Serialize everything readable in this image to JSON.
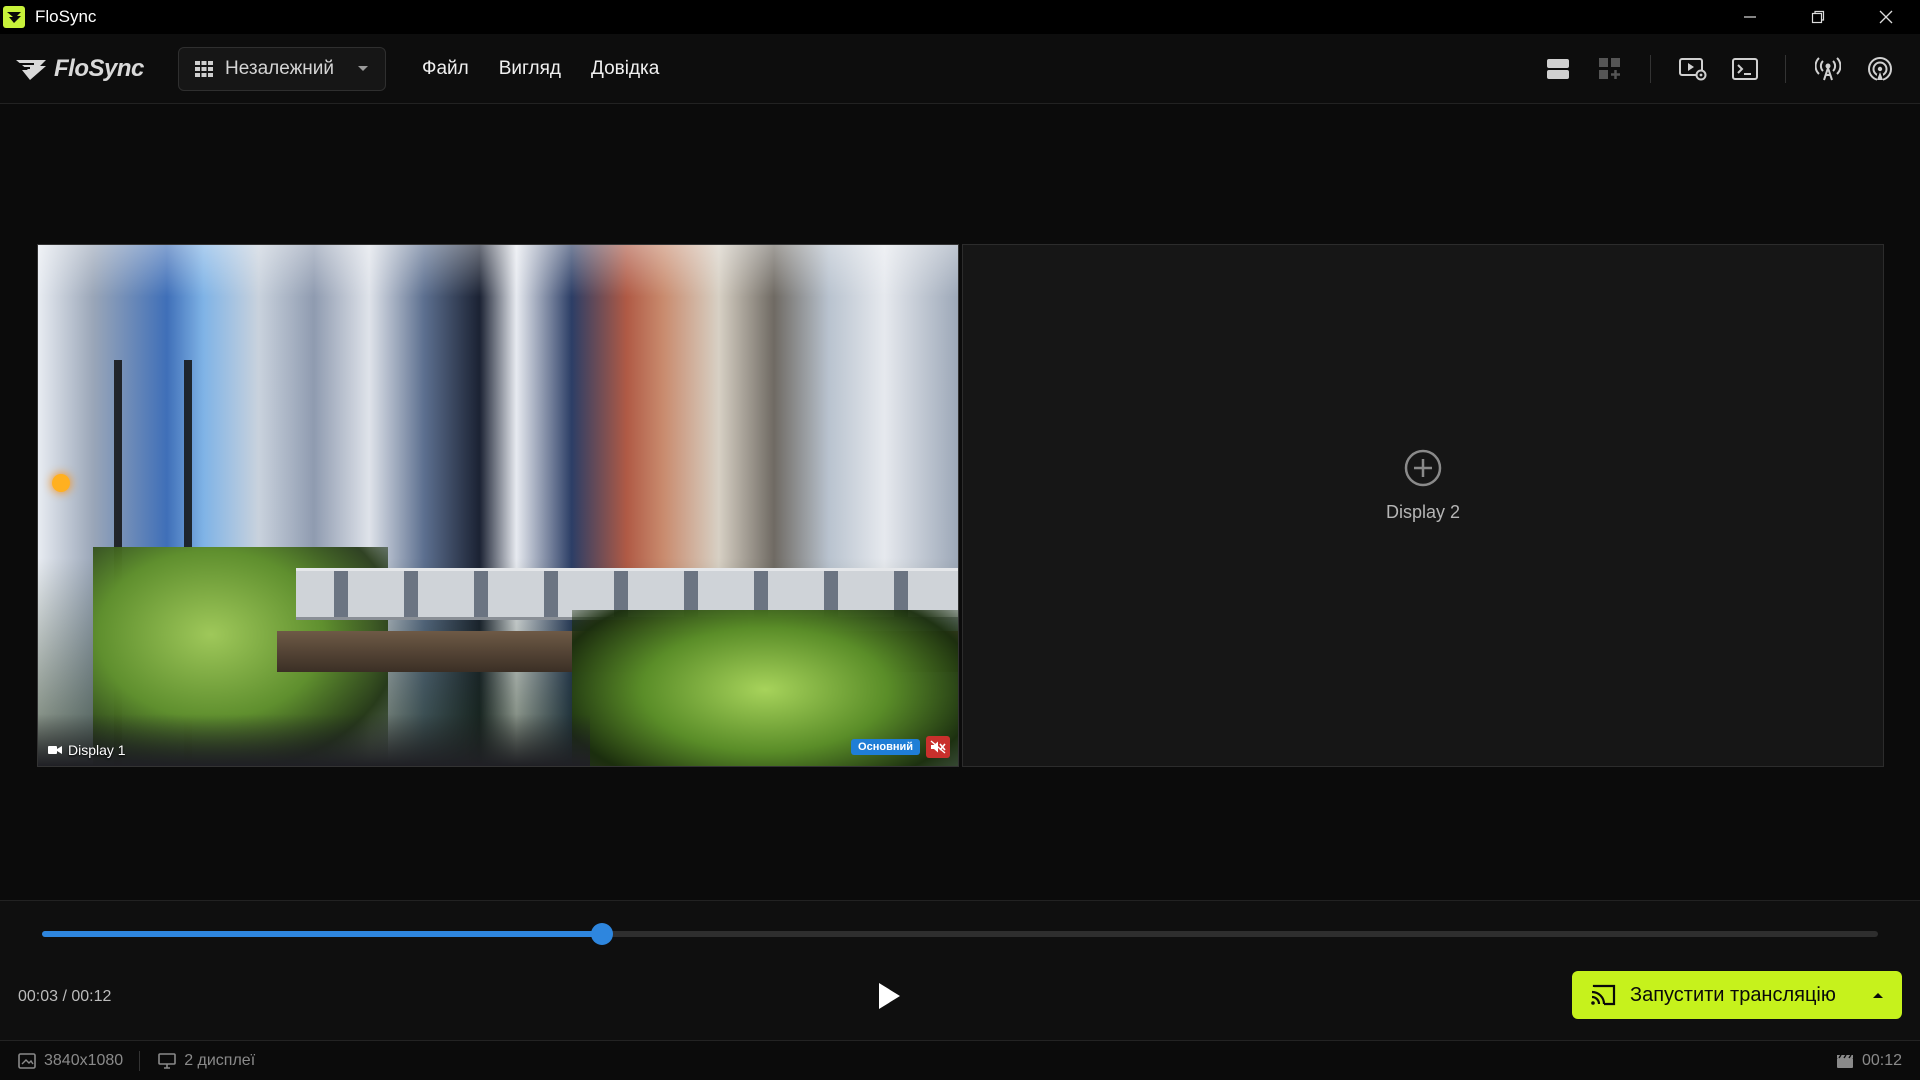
{
  "window": {
    "title": "FloSync",
    "minimize_icon": "minimize-icon",
    "restore_icon": "restore-icon",
    "close_icon": "close-icon"
  },
  "brand": {
    "logo_text": "FloSync"
  },
  "mode_select": {
    "value": "Незалежний"
  },
  "menu": {
    "file": "Файл",
    "view": "Вигляд",
    "help": "Довідка"
  },
  "toolbar": {
    "icons": [
      "layout-rows-icon",
      "layout-grid-add-icon",
      "media-settings-icon",
      "terminal-icon",
      "broadcast-antenna-icon",
      "airplay-signal-icon"
    ]
  },
  "displays": {
    "display1": {
      "label": "Display 1",
      "badge": "Основний",
      "muted": true
    },
    "display2": {
      "label": "Display 2"
    }
  },
  "playback": {
    "current": "00:03",
    "total": "00:12",
    "readout": "00:03 / 00:12",
    "progress": 0.305
  },
  "cast_button": {
    "label": "Запустити трансляцію"
  },
  "status": {
    "resolution": "3840x1080",
    "displays_count": "2 дисплеї",
    "duration": "00:12"
  },
  "colors": {
    "accent_green": "#c6f21c",
    "accent_blue": "#2e86de",
    "badge_blue": "#1f7ed6",
    "mute_red": "#c9302c"
  }
}
